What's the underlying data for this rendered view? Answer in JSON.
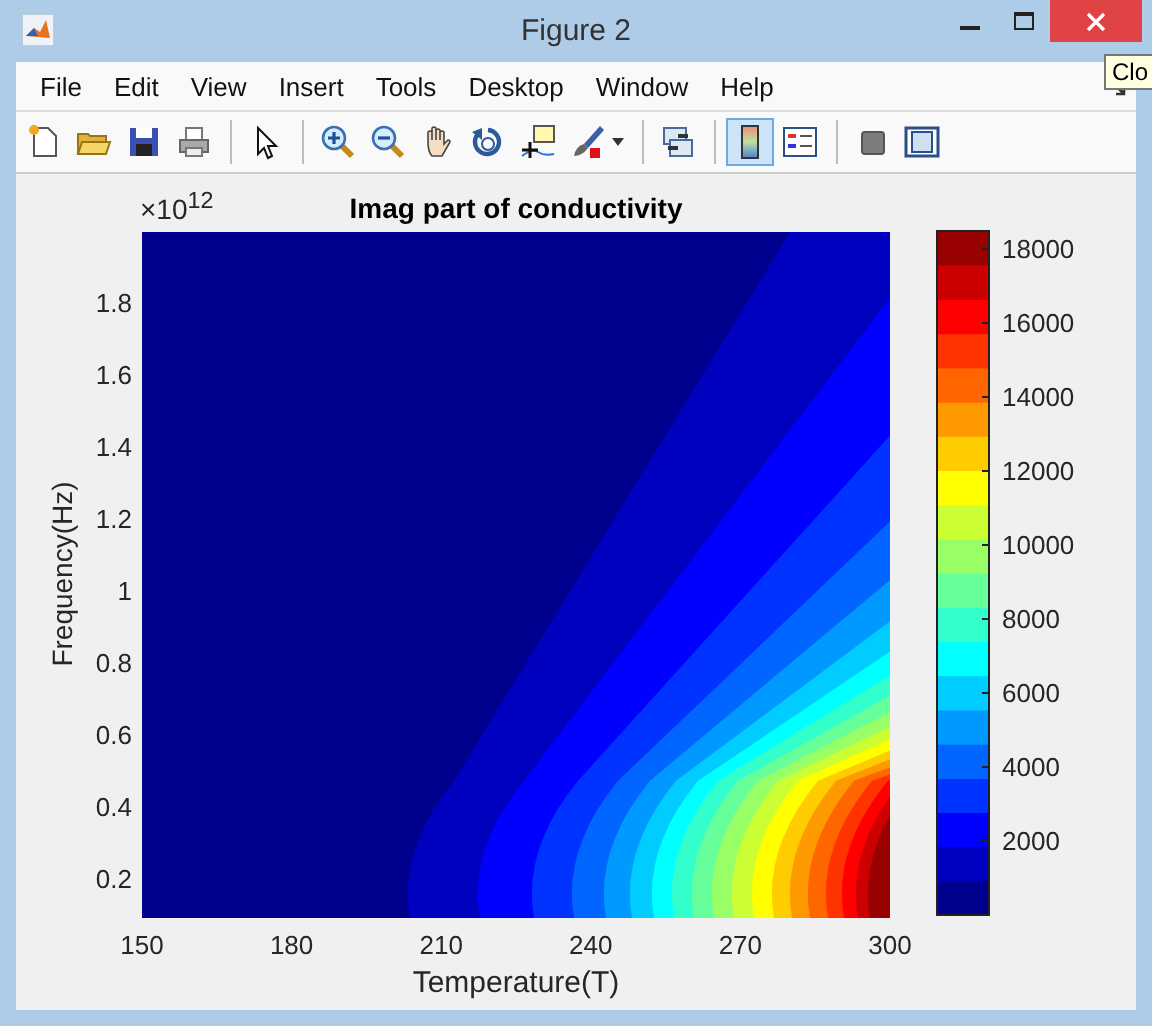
{
  "window": {
    "title": "Figure 2"
  },
  "menu": [
    "File",
    "Edit",
    "View",
    "Insert",
    "Tools",
    "Desktop",
    "Window",
    "Help"
  ],
  "tooltip": "Clo",
  "toolbar": [
    {
      "selected": false
    },
    {
      "selected": false
    },
    {
      "selected": false
    },
    {
      "selected": false
    },
    {
      "selected": false
    },
    {
      "selected": false
    },
    {
      "selected": false
    },
    {
      "selected": false
    },
    {
      "selected": false
    },
    {
      "selected": false
    },
    {
      "selected": false
    },
    {
      "selected": false
    },
    {
      "selected": true
    },
    {
      "selected": false
    },
    {
      "selected": false
    },
    {
      "selected": false
    }
  ],
  "plot": {
    "title": "Imag part of conductivity",
    "exponent": "×10$^{12}$",
    "xlabel": "Temperature(T)",
    "ylabel": "Frequency(Hz)",
    "xticks": [
      "150",
      "180",
      "210",
      "240",
      "270",
      "300"
    ],
    "yticks": [
      "1.8",
      "1.6",
      "1.4",
      "1.2",
      "1",
      "0.8",
      "0.6",
      "0.4",
      "0.2"
    ],
    "colorbar_ticks": [
      "18000",
      "16000",
      "14000",
      "12000",
      "10000",
      "8000",
      "6000",
      "4000",
      "2000"
    ]
  }
}
